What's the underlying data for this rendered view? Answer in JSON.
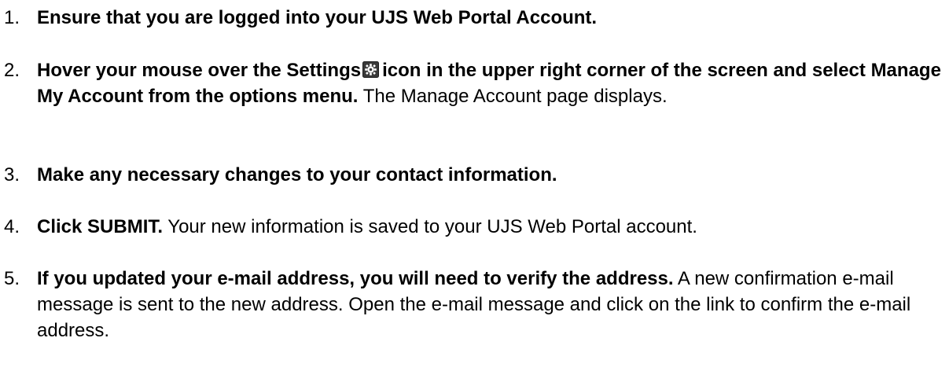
{
  "steps": [
    {
      "number": "1.",
      "bold": "Ensure that you are logged into your UJS Web Portal Account.",
      "normal": ""
    },
    {
      "number": "2.",
      "bold_before_icon": "Hover your mouse over the Settings",
      "icon": "settings-gear-icon",
      "bold_after_icon": "icon in the upper right corner of the screen and select Manage My Account from the options menu.",
      "normal": "The Manage Account page displays."
    },
    {
      "number": "3.",
      "bold": "Make any necessary changes to your contact information.",
      "normal": ""
    },
    {
      "number": "4.",
      "bold": "Click SUBMIT.",
      "normal": "Your new information is saved to your UJS Web Portal account."
    },
    {
      "number": "5.",
      "bold": "If you updated your e-mail address, you will need to verify the address.",
      "normal": "A new confirmation e-mail message is sent to the new address. Open the e-mail message and click on the link to confirm the e-mail address."
    }
  ]
}
